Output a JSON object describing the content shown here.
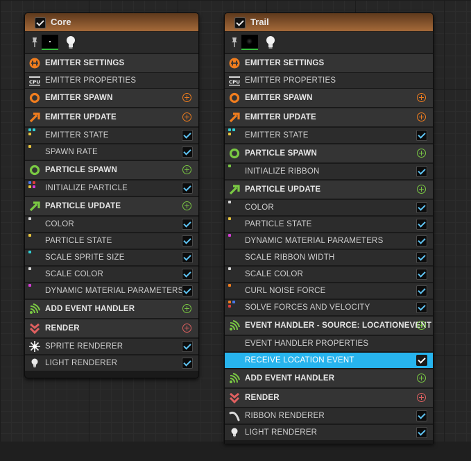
{
  "colors": {
    "header_orange": "#a56a39",
    "emitter_orange": "#f07d1e",
    "particle_green": "#7ac943",
    "render_red": "#e06060",
    "selection_blue": "#27b4ee",
    "checkmark_blue": "#5ec3f2",
    "thumbnail_bar_green": "#36c23d"
  },
  "core": {
    "title": "Core",
    "enabled": true,
    "rows": {
      "emitter_settings": {
        "label": "EMITTER SETTINGS",
        "icon": "emitter-settings-icon"
      },
      "emitter_properties": {
        "label": "EMITTER PROPERTIES",
        "icon": "cpu-icon"
      },
      "emitter_spawn": {
        "label": "EMITTER SPAWN",
        "icon": "ring-icon"
      },
      "emitter_update": {
        "label": "EMITTER UPDATE",
        "icon": "arrow-up-right-icon"
      },
      "emitter_state": {
        "label": "EMITTER STATE",
        "icon": "module-dots-icon",
        "enabled": true
      },
      "spawn_rate": {
        "label": "SPAWN RATE",
        "icon": "module-dot-icon",
        "enabled": true
      },
      "particle_spawn": {
        "label": "PARTICLE SPAWN",
        "icon": "ring-icon"
      },
      "initialize_particle": {
        "label": "INITIALIZE PARTICLE",
        "icon": "module-dots-icon",
        "enabled": true
      },
      "particle_update": {
        "label": "PARTICLE UPDATE",
        "icon": "arrow-up-right-icon"
      },
      "color": {
        "label": "COLOR",
        "icon": "module-dot-icon",
        "enabled": true
      },
      "particle_state": {
        "label": "PARTICLE STATE",
        "icon": "module-dot-icon",
        "enabled": true
      },
      "scale_sprite_size": {
        "label": "SCALE SPRITE SIZE",
        "icon": "module-dot-icon",
        "enabled": true
      },
      "scale_color": {
        "label": "SCALE COLOR",
        "icon": "module-dot-icon",
        "enabled": true
      },
      "dynamic_material_parameters": {
        "label": "DYNAMIC MATERIAL PARAMETERS",
        "icon": "module-dot-icon",
        "enabled": true
      },
      "add_event_handler": {
        "label": "ADD EVENT HANDLER",
        "icon": "event-handler-icon"
      },
      "render": {
        "label": "RENDER",
        "icon": "render-icon"
      },
      "sprite_renderer": {
        "label": "SPRITE RENDERER",
        "icon": "sprite-icon",
        "enabled": true
      },
      "light_renderer": {
        "label": "LIGHT RENDERER",
        "icon": "lightbulb-icon",
        "enabled": true
      }
    }
  },
  "trail": {
    "title": "Trail",
    "enabled": true,
    "rows": {
      "emitter_settings": {
        "label": "EMITTER SETTINGS",
        "icon": "emitter-settings-icon"
      },
      "emitter_properties": {
        "label": "EMITTER PROPERTIES",
        "icon": "cpu-icon"
      },
      "emitter_spawn": {
        "label": "EMITTER SPAWN",
        "icon": "ring-icon"
      },
      "emitter_update": {
        "label": "EMITTER UPDATE",
        "icon": "arrow-up-right-icon"
      },
      "emitter_state": {
        "label": "EMITTER STATE",
        "icon": "module-dots-icon",
        "enabled": true
      },
      "particle_spawn": {
        "label": "PARTICLE SPAWN",
        "icon": "ring-icon"
      },
      "initialize_ribbon": {
        "label": "INITIALIZE RIBBON",
        "icon": "module-dot-icon",
        "enabled": true
      },
      "particle_update": {
        "label": "PARTICLE UPDATE",
        "icon": "arrow-up-right-icon"
      },
      "color": {
        "label": "COLOR",
        "icon": "module-dot-icon",
        "enabled": true
      },
      "particle_state": {
        "label": "PARTICLE STATE",
        "icon": "module-dot-icon",
        "enabled": true
      },
      "dynamic_material_parameters": {
        "label": "DYNAMIC MATERIAL PARAMETERS",
        "icon": "module-dot-icon",
        "enabled": true
      },
      "scale_ribbon_width": {
        "label": "SCALE RIBBON WIDTH",
        "enabled": true
      },
      "scale_color": {
        "label": "SCALE COLOR",
        "icon": "module-dot-icon",
        "enabled": true
      },
      "curl_noise_force": {
        "label": "CURL NOISE FORCE",
        "icon": "module-dot-icon",
        "enabled": true
      },
      "solve_forces_and_velocity": {
        "label": "SOLVE FORCES AND VELOCITY",
        "icon": "module-dots-icon",
        "enabled": true
      },
      "event_handler_source": {
        "label": "EVENT HANDLER - SOURCE: LOCATIONEVENT",
        "icon": "event-handler-icon"
      },
      "event_handler_properties": {
        "label": "EVENT HANDLER PROPERTIES"
      },
      "receive_location_event": {
        "label": "RECEIVE LOCATION EVENT",
        "enabled": true,
        "selected": true
      },
      "add_event_handler": {
        "label": "ADD EVENT HANDLER",
        "icon": "event-handler-icon"
      },
      "render": {
        "label": "RENDER",
        "icon": "render-icon"
      },
      "ribbon_renderer": {
        "label": "RIBBON RENDERER",
        "icon": "ribbon-icon",
        "enabled": true
      },
      "light_renderer": {
        "label": "LIGHT RENDERER",
        "icon": "lightbulb-icon",
        "enabled": true
      }
    }
  }
}
